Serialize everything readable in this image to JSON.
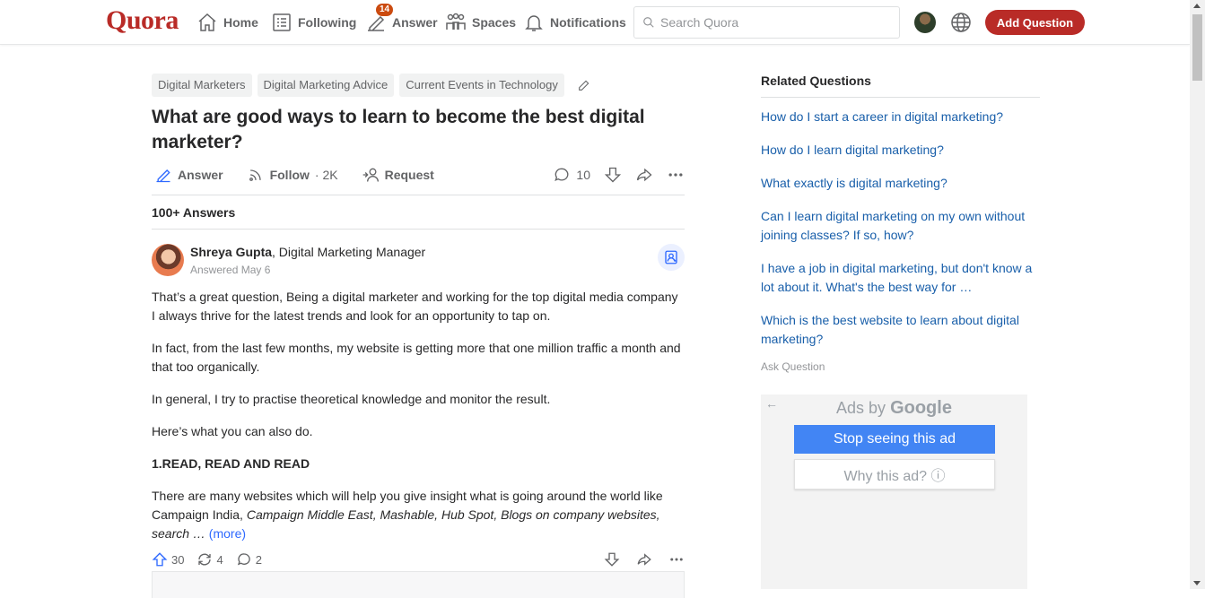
{
  "header": {
    "logo": "Quora",
    "nav": [
      {
        "label": "Home",
        "icon": "home-icon"
      },
      {
        "label": "Following",
        "icon": "following-icon"
      },
      {
        "label": "Answer",
        "icon": "answer-pencil-icon",
        "badge": "14"
      },
      {
        "label": "Spaces",
        "icon": "spaces-icon"
      },
      {
        "label": "Notifications",
        "icon": "bell-icon"
      }
    ],
    "search_placeholder": "Search Quora",
    "add_question": "Add Question"
  },
  "question": {
    "topics": [
      "Digital Marketers",
      "Digital Marketing Advice",
      "Current Events in Technology"
    ],
    "title": "What are good ways to learn to become the best digital marketer?",
    "actions": {
      "answer": "Answer",
      "follow": "Follow",
      "follow_count": "· 2K",
      "request": "Request",
      "comments": "10"
    },
    "answers_count": "100+ Answers"
  },
  "answer": {
    "author_name": "Shreya Gupta",
    "author_credential": ", Digital Marketing Manager",
    "answered": "Answered May 6",
    "paragraphs": [
      "That’s a great question, Being a digital marketer and working for the top digital media company I always thrive for the latest trends and look for an opportunity to tap on.",
      "In fact, from the last few months, my website is getting more that one million traffic a month and that too organically.",
      "In general, I try to practise theoretical knowledge and monitor the result.",
      "Here’s what you can also do."
    ],
    "heading": "1.READ, READ AND READ",
    "last_paragraph_plain": "There are many websites which will help you give insight what is going around the world like Campaign India, ",
    "last_paragraph_italic": "Campaign Middle East, Mashable, Hub Spot, Blogs on company websites, search …",
    "more_link": " (more)",
    "upvotes": "30",
    "shares": "4",
    "comments": "2"
  },
  "sidebar": {
    "title": "Related Questions",
    "questions": [
      "How do I start a career in digital marketing?",
      "How do I learn digital marketing?",
      "What exactly is digital marketing?",
      "Can I learn digital marketing on my own without joining classes? If so, how?",
      "I have a job in digital marketing, but don't know a lot about it. What's the best way for …",
      "Which is the best website to learn about digital marketing?"
    ],
    "ask_question": "Ask Question"
  },
  "ad": {
    "back": "←",
    "ads_by": "Ads by ",
    "google": "Google",
    "stop": "Stop seeing this ad",
    "why": "Why this ad? ⓘ"
  },
  "colors": {
    "brand": "#b92b27",
    "link": "#195faa",
    "ad_blue": "#4285f4"
  }
}
